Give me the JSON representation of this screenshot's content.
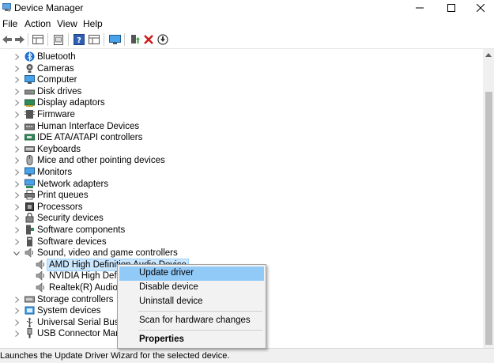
{
  "window": {
    "title": "Device Manager",
    "minimize_icon": "minimize-icon",
    "maximize_icon": "maximize-icon",
    "close_icon": "close-icon"
  },
  "menubar": {
    "items": [
      "File",
      "Action",
      "View",
      "Help"
    ]
  },
  "toolbar": {
    "buttons": [
      "back-arrow-icon",
      "forward-arrow-icon",
      "properties-grid-icon",
      "page-icon",
      "help-icon",
      "list-icon",
      "monitor-icon",
      "add-driver-icon",
      "uninstall-x-icon",
      "download-circle-icon"
    ]
  },
  "tree": {
    "categories": [
      {
        "label": "Bluetooth",
        "icon": "bluetooth-icon",
        "expanded": false
      },
      {
        "label": "Cameras",
        "icon": "camera-icon",
        "expanded": false
      },
      {
        "label": "Computer",
        "icon": "computer-icon",
        "expanded": false
      },
      {
        "label": "Disk drives",
        "icon": "disk-drive-icon",
        "expanded": false
      },
      {
        "label": "Display adaptors",
        "icon": "display-adapter-icon",
        "expanded": false
      },
      {
        "label": "Firmware",
        "icon": "firmware-icon",
        "expanded": false
      },
      {
        "label": "Human Interface Devices",
        "icon": "hid-icon",
        "expanded": false
      },
      {
        "label": "IDE ATA/ATAPI controllers",
        "icon": "ide-controller-icon",
        "expanded": false
      },
      {
        "label": "Keyboards",
        "icon": "keyboard-icon",
        "expanded": false
      },
      {
        "label": "Mice and other pointing devices",
        "icon": "mouse-icon",
        "expanded": false
      },
      {
        "label": "Monitors",
        "icon": "monitor-icon",
        "expanded": false
      },
      {
        "label": "Network adapters",
        "icon": "network-adapter-icon",
        "expanded": false
      },
      {
        "label": "Print queues",
        "icon": "printer-icon",
        "expanded": false
      },
      {
        "label": "Processors",
        "icon": "processor-icon",
        "expanded": false
      },
      {
        "label": "Security devices",
        "icon": "security-device-icon",
        "expanded": false
      },
      {
        "label": "Software components",
        "icon": "software-component-icon",
        "expanded": false
      },
      {
        "label": "Software devices",
        "icon": "software-device-icon",
        "expanded": false
      },
      {
        "label": "Sound, video and game controllers",
        "icon": "speaker-icon",
        "expanded": true
      },
      {
        "label": "Storage controllers",
        "icon": "storage-controller-icon",
        "expanded": false
      },
      {
        "label": "System devices",
        "icon": "system-device-icon",
        "expanded": false
      },
      {
        "label": "Universal Serial Bus con",
        "icon": "usb-icon",
        "expanded": false
      },
      {
        "label": "USB Connector Manage",
        "icon": "usb-connector-icon",
        "expanded": false
      }
    ],
    "sound_children": [
      {
        "label": "AMD High Definition Audio Device",
        "icon": "speaker-icon",
        "selected": true
      },
      {
        "label": "NVIDIA High Definit",
        "icon": "speaker-icon",
        "selected": false
      },
      {
        "label": "Realtek(R) Audio",
        "icon": "speaker-icon",
        "selected": false
      }
    ]
  },
  "context_menu": {
    "items": [
      {
        "label": "Update driver",
        "highlighted": true,
        "bold": false
      },
      {
        "label": "Disable device",
        "highlighted": false,
        "bold": false
      },
      {
        "label": "Uninstall device",
        "highlighted": false,
        "bold": false
      },
      {
        "label": "Scan for hardware changes",
        "highlighted": false,
        "bold": false
      },
      {
        "label": "Properties",
        "highlighted": false,
        "bold": true
      }
    ]
  },
  "statusbar": {
    "text": "Launches the Update Driver Wizard for the selected device."
  },
  "colors": {
    "selection": "#cce8ff",
    "menu_highlight": "#91c9f7",
    "accent_blue": "#0078d7"
  }
}
